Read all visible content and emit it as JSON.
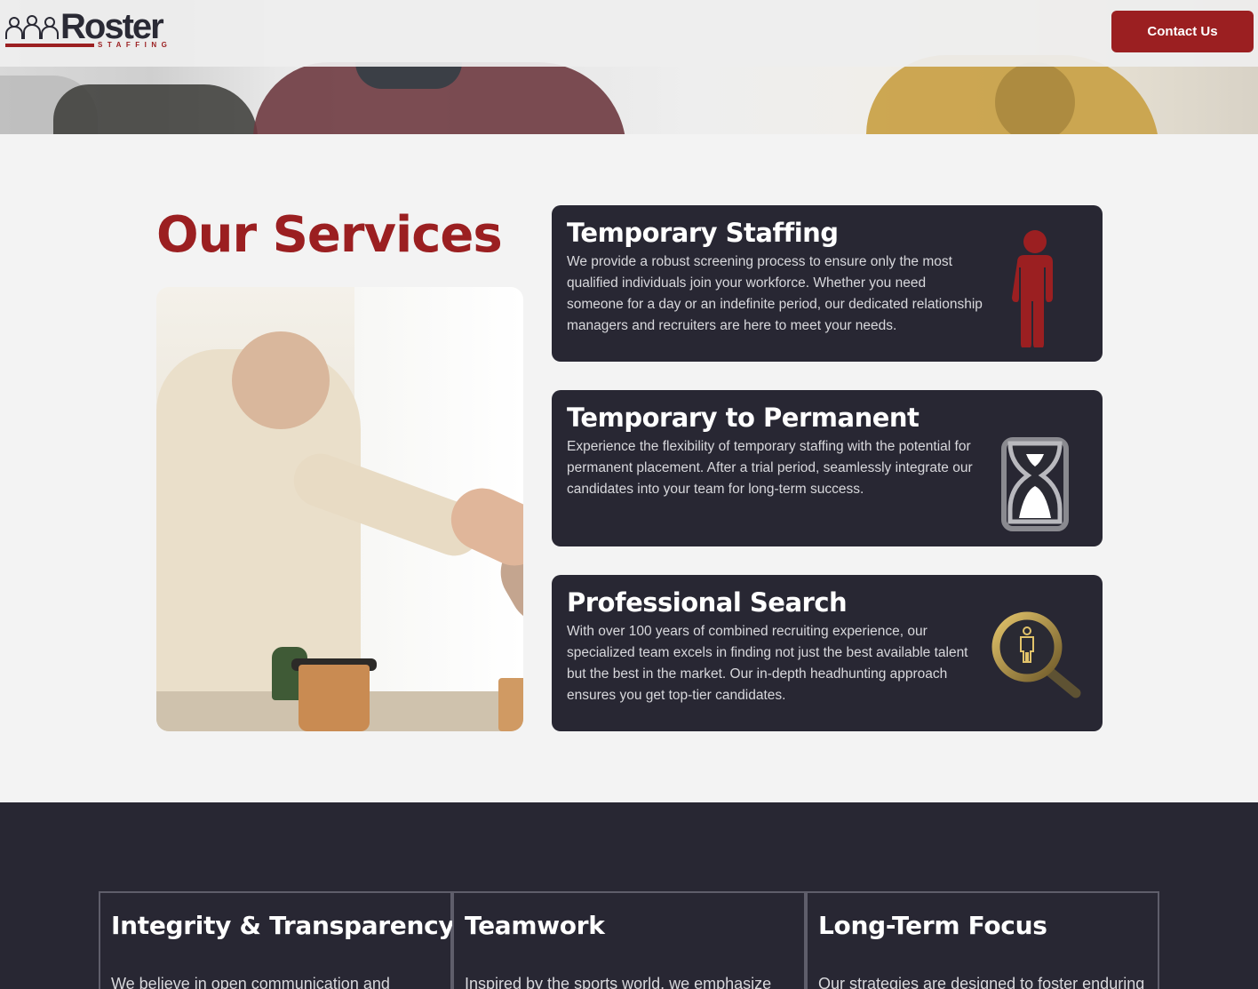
{
  "header": {
    "logo_text": "Roster",
    "logo_sub": "STAFFING",
    "contact_label": "Contact Us"
  },
  "services": {
    "title": "Our Services",
    "cards": [
      {
        "title": "Temporary Staffing",
        "body": "We provide a robust screening process to ensure only the most qualified individuals join your workforce. Whether you need someone for a day or an indefinite period, our dedicated relationship managers and recruiters are here to meet your needs.",
        "icon": "person-icon"
      },
      {
        "title": "Temporary to Permanent",
        "body": "Experience the flexibility of temporary staffing with the potential for permanent placement. After a trial period, seamlessly integrate our candidates into your team for long-term success.",
        "icon": "hourglass-icon"
      },
      {
        "title": "Professional Search",
        "body": "With over 100 years of combined recruiting experience, our specialized team excels in finding not just the best available talent but the best in the market. Our in-depth headhunting approach ensures you get top-tier candidates.",
        "icon": "magnifier-person-icon"
      }
    ]
  },
  "values": [
    {
      "title": "Integrity & Transparency",
      "body": "We believe in open communication and"
    },
    {
      "title": "Teamwork",
      "body": "Inspired by the sports world, we emphasize"
    },
    {
      "title": "Long-Term Focus",
      "body": "Our strategies are designed to foster enduring"
    }
  ],
  "colors": {
    "brand_red": "#9b1f21",
    "dark": "#282733",
    "gold": "#c9a24a"
  }
}
